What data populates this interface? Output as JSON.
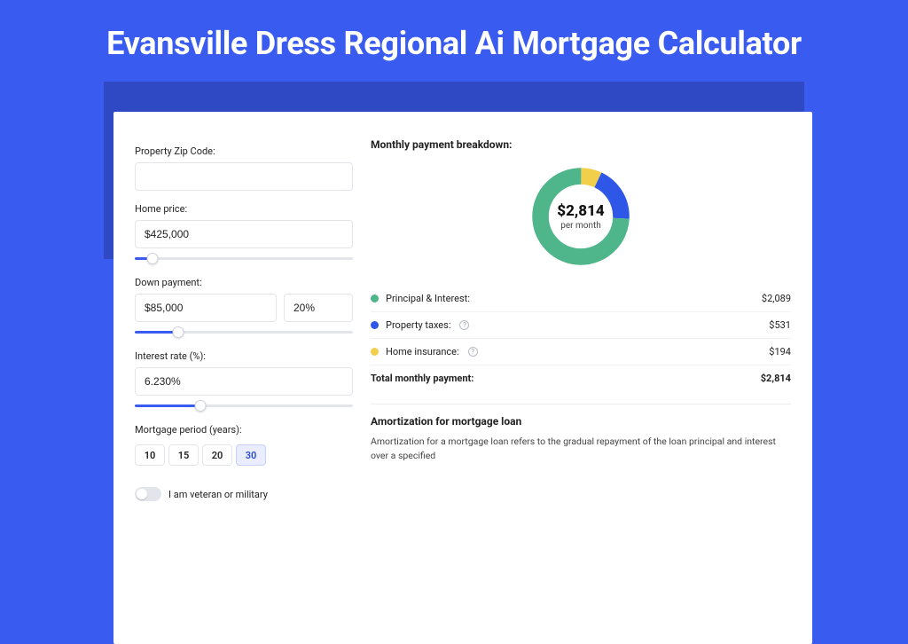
{
  "hero": {
    "title": "Evansville Dress Regional Ai Mortgage Calculator"
  },
  "form": {
    "zip_label": "Property Zip Code:",
    "zip_value": "",
    "home_price_label": "Home price:",
    "home_price_value": "$425,000",
    "home_price_slider_pct": 8,
    "down_payment_label": "Down payment:",
    "down_payment_value": "$85,000",
    "down_payment_pct_value": "20%",
    "down_payment_slider_pct": 20,
    "interest_label": "Interest rate (%):",
    "interest_value": "6.230%",
    "interest_slider_pct": 30,
    "period_label": "Mortgage period (years):",
    "periods": [
      "10",
      "15",
      "20",
      "30"
    ],
    "period_active": "30",
    "veteran_label": "I am veteran or military",
    "veteran_on": false
  },
  "breakdown": {
    "title": "Monthly payment breakdown:",
    "total_amount": "$2,814",
    "total_sub": "per month",
    "items": [
      {
        "key": "pi",
        "label": "Principal & Interest:",
        "value": "$2,089",
        "color": "#4fb58a",
        "info": false
      },
      {
        "key": "tax",
        "label": "Property taxes:",
        "value": "$531",
        "color": "#2e57e8",
        "info": true
      },
      {
        "key": "ins",
        "label": "Home insurance:",
        "value": "$194",
        "color": "#f2cf4a",
        "info": true
      }
    ],
    "total_row": {
      "label": "Total monthly payment:",
      "value": "$2,814"
    }
  },
  "chart_data": {
    "type": "pie",
    "title": "Monthly payment breakdown",
    "series": [
      {
        "name": "Principal & Interest",
        "value": 2089,
        "color": "#4fb58a"
      },
      {
        "name": "Property taxes",
        "value": 531,
        "color": "#2e57e8"
      },
      {
        "name": "Home insurance",
        "value": 194,
        "color": "#f2cf4a"
      }
    ],
    "total": 2814,
    "center_label": "$2,814",
    "center_sub": "per month"
  },
  "amortization": {
    "title": "Amortization for mortgage loan",
    "body": "Amortization for a mortgage loan refers to the gradual repayment of the loan principal and interest over a specified"
  }
}
